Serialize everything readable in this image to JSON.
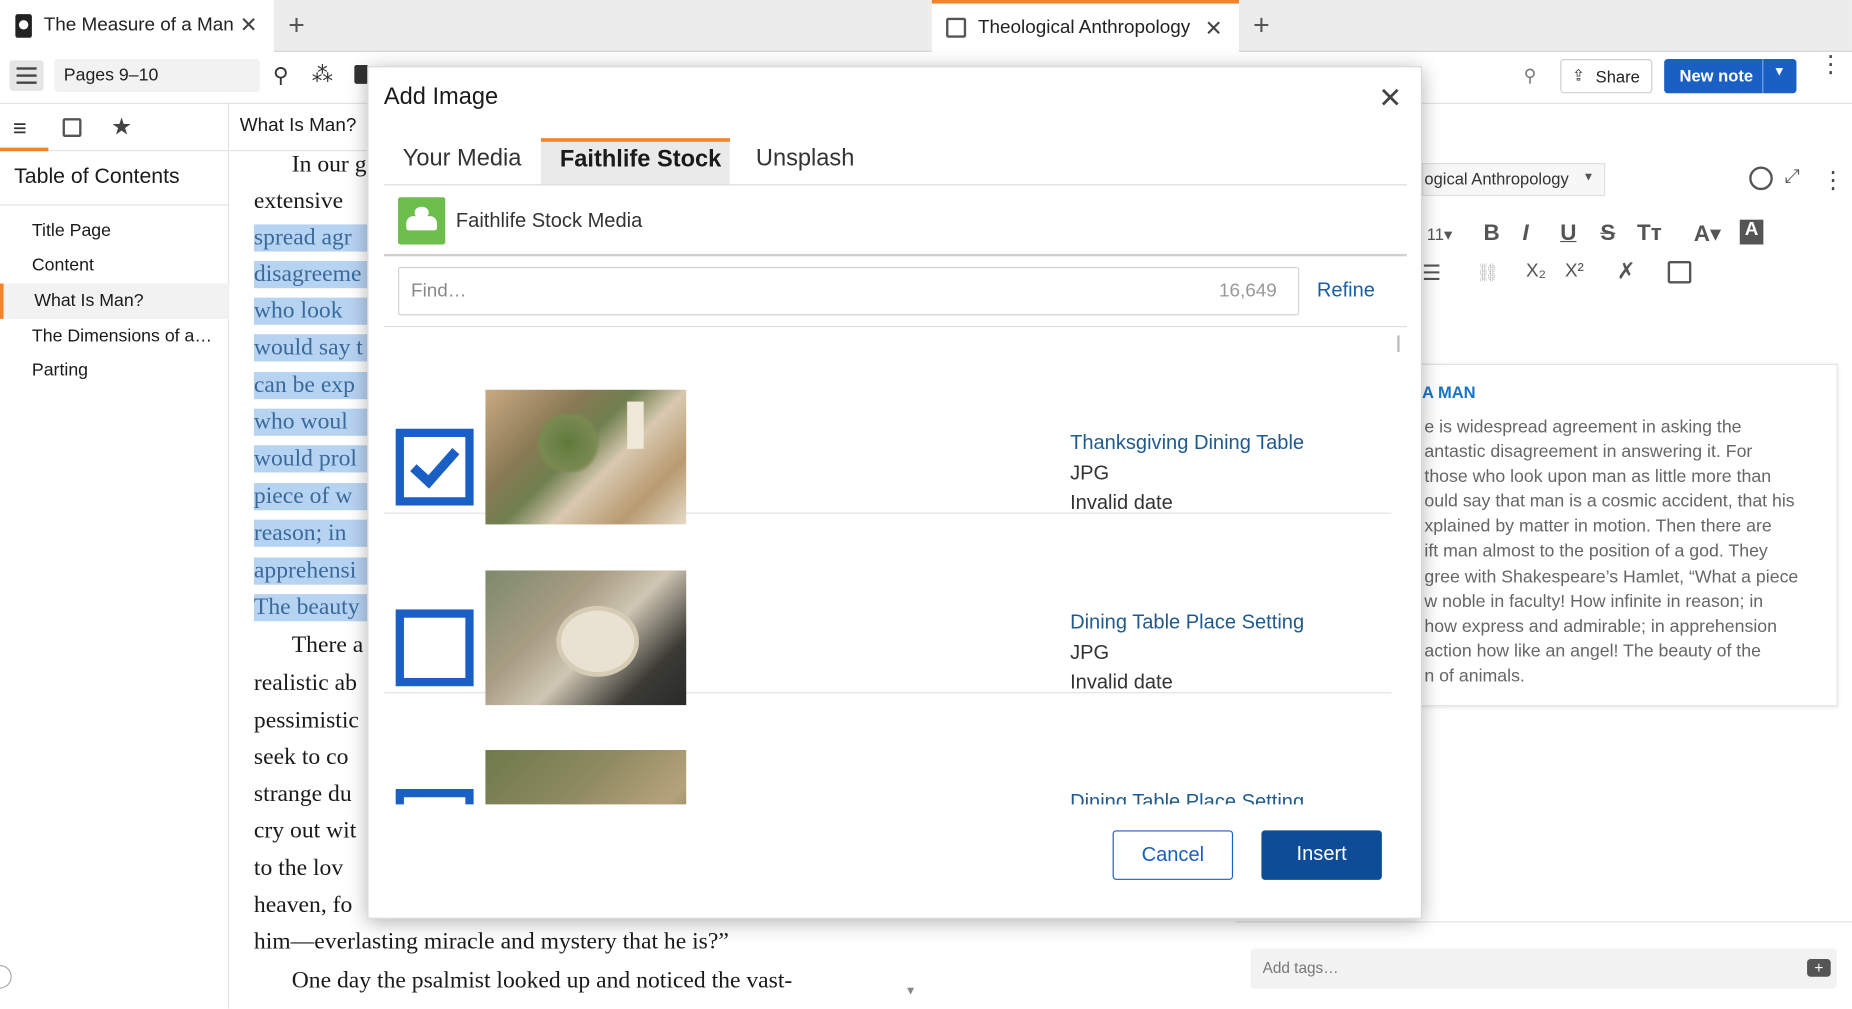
{
  "left_panel": {
    "tab_title": "The Measure of a Man",
    "page_ref": "Pages 9–10",
    "section_title": "What Is Man?",
    "toc": {
      "title": "Table of Contents",
      "items": [
        "Title Page",
        "Content",
        "What Is Man?",
        "The Dimensions of a…",
        "Parting"
      ]
    },
    "text_lines": [
      "In our g",
      "extensive",
      "spread agr",
      "disagreeme",
      "who  look",
      "would say t",
      "can be exp",
      "who  woul",
      "would  prol",
      "piece of w",
      "reason;  in",
      "apprehensi",
      "The beauty",
      "There  a",
      "realistic  ab",
      "pessimistic",
      "seek  to  co",
      "strange  du",
      "cry  out wit",
      "to  the  lov",
      "heaven,  fo",
      "him—everlasting miracle and mystery that he is?”",
      "One  day  the  psalmist  looked  up  and  noticed  the  vast-"
    ]
  },
  "right_panel": {
    "tab_title": "Theological Anthropology",
    "share_label": "Share",
    "new_note_label": "New note",
    "notebook_label": "ogical Anthropology",
    "font_size": "11",
    "note_heading": "A MAN",
    "note_lines": [
      "e is widespread agreement in asking the",
      "antastic disagreement in answering it. For",
      " those who look upon man as little more than",
      "ould say that man is a cosmic accident, that his",
      "xplained by matter in motion. Then there are",
      "ift man almost to the position of a god. They",
      "gree with Shakespeare’s Hamlet, “What a piece",
      "w noble in faculty! How infinite in reason; in",
      "how express and admirable; in apprehension",
      "action how like an angel! The beauty of the",
      "n of animals."
    ],
    "tags_placeholder": "Add tags…"
  },
  "dialog": {
    "title": "Add Image",
    "tabs": [
      "Your Media",
      "Faithlife Stock",
      "Unsplash"
    ],
    "active_tab": "Faithlife Stock",
    "source_name": "Faithlife Stock Media",
    "search_placeholder": "Find…",
    "result_count": "16,649",
    "refine_label": "Refine",
    "results": [
      {
        "title": "Thanksgiving Dining Table",
        "format": "JPG",
        "date": "Invalid date",
        "checked": true
      },
      {
        "title": "Dining Table Place Setting",
        "format": "JPG",
        "date": "Invalid date",
        "checked": false
      },
      {
        "title": "Dining Table Place Setting",
        "format": "",
        "date": "",
        "checked": false
      }
    ],
    "cancel_label": "Cancel",
    "insert_label": "Insert"
  },
  "colors": {
    "accent": "#1a5fc4",
    "tab_highlight": "#f2832a",
    "selection": "#b7d3f2",
    "stock_green": "#6bbf4a"
  }
}
